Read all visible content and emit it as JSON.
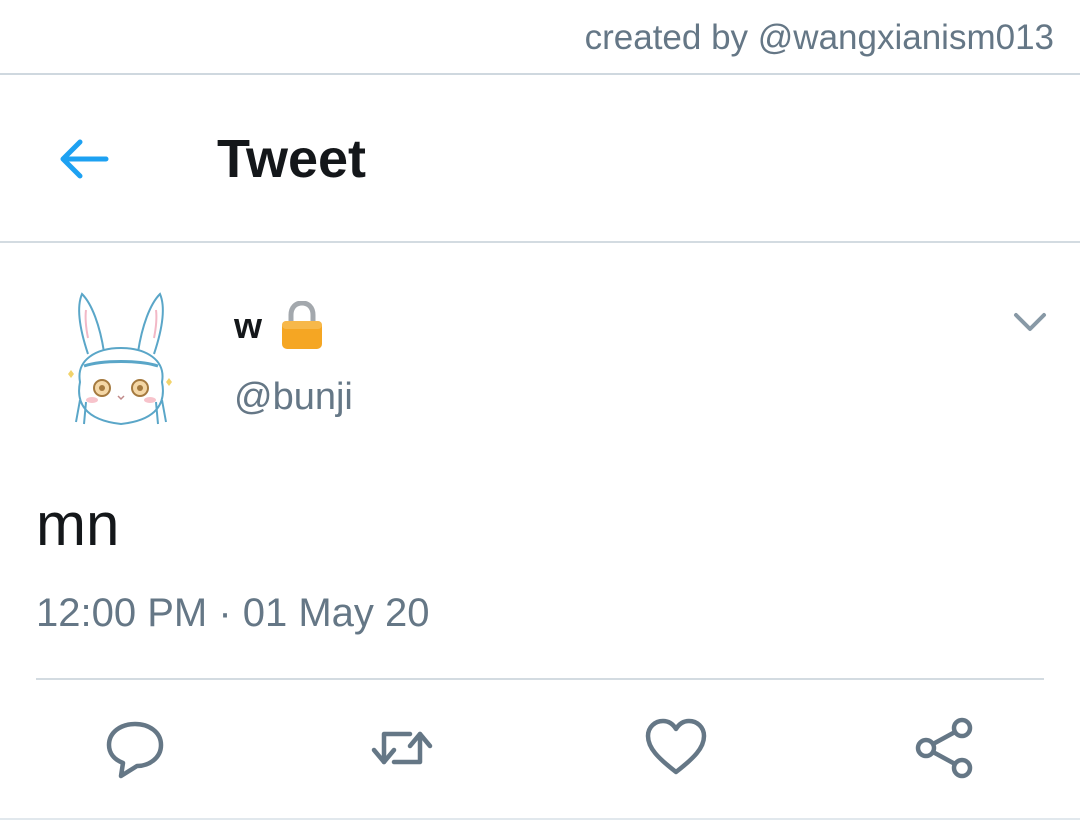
{
  "credit": {
    "text": "created by @wangxianism013"
  },
  "header": {
    "title": "Tweet",
    "back_icon": "arrow-left-icon"
  },
  "tweet": {
    "author": {
      "display_name": "w",
      "handle": "@bunji",
      "protected_icon": "lock-icon",
      "avatar": "bunny-avatar"
    },
    "text": "mn",
    "timestamp": "12:00 PM · 01 May 20"
  },
  "actions": [
    {
      "icon": "reply-icon"
    },
    {
      "icon": "retweet-icon"
    },
    {
      "icon": "like-icon"
    },
    {
      "icon": "share-icon"
    }
  ],
  "colors": {
    "accent": "#1da1f2",
    "secondary_text": "#657786",
    "primary_text": "#14171a",
    "divider": "#d3dbe1",
    "lock": "#f5a623"
  }
}
